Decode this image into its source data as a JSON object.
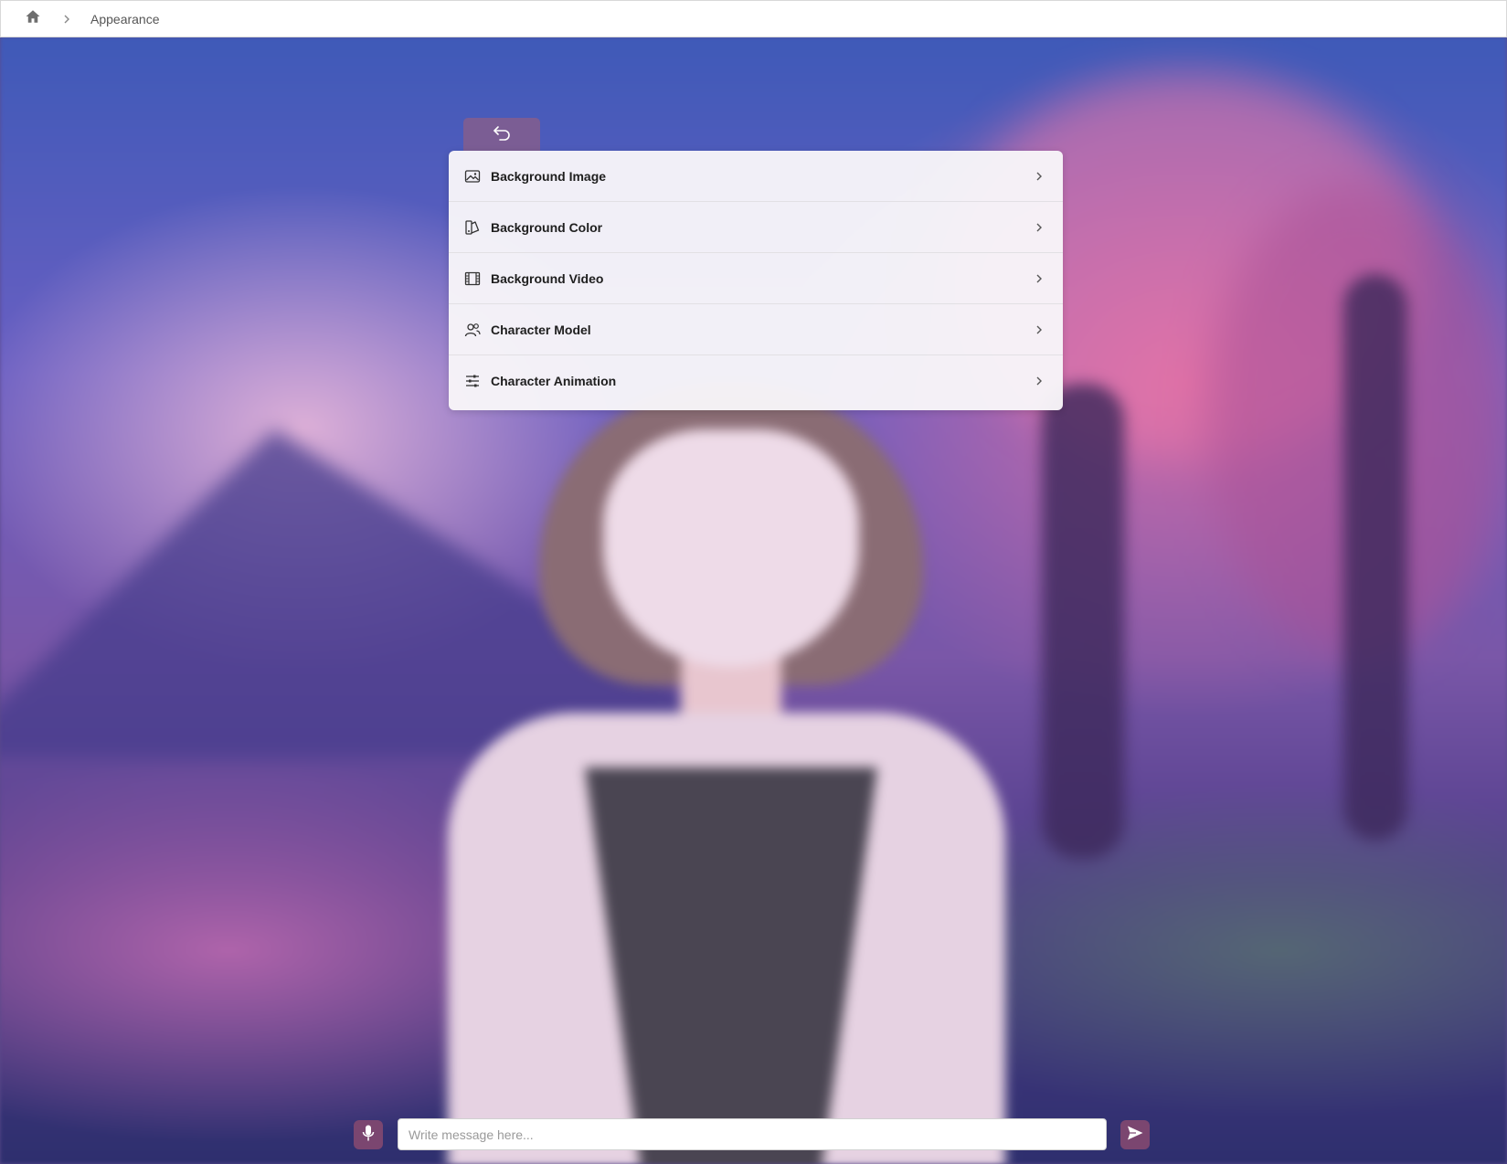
{
  "header": {
    "home_icon": "home-icon",
    "separator_icon": "chevron-right-icon",
    "breadcrumb_current": "Appearance"
  },
  "panel": {
    "back_icon": "undo-arrow-icon",
    "accent_color": "#7b5d94",
    "items": [
      {
        "label": "Background Image",
        "icon": "image-icon"
      },
      {
        "label": "Background Color",
        "icon": "palette-icon"
      },
      {
        "label": "Background Video",
        "icon": "film-icon"
      },
      {
        "label": "Character Model",
        "icon": "users-icon"
      },
      {
        "label": "Character Animation",
        "icon": "sliders-icon"
      }
    ]
  },
  "chat": {
    "placeholder": "Write message here...",
    "value": "",
    "mic_icon": "microphone-icon",
    "send_icon": "send-icon",
    "button_color": "#7b4670"
  }
}
